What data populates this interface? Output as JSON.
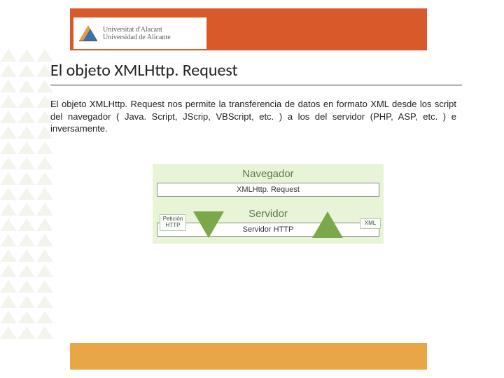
{
  "university": {
    "name_ca": "Universitat d'Alacant",
    "name_es": "Universidad de Alicante"
  },
  "title": "El objeto XMLHttp. Request",
  "body": "El objeto XMLHttp. Request nos permite la transferencia de datos en formato XML desde los script del navegador ( Java. Script, JScrip, VBScript, etc. ) a los del servidor (PHP, ASP, etc. ) e inversamente.",
  "diagram": {
    "browser_label": "Navegador",
    "browser_component": "XMLHttp. Request",
    "server_label": "Servidor",
    "server_component": "Servidor HTTP",
    "request_label": "Petición\nHTTP",
    "response_label": "XML"
  }
}
